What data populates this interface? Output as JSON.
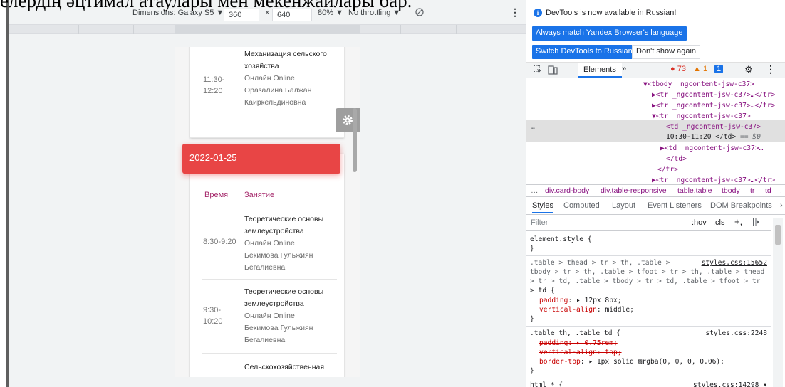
{
  "doc_heading": "елердің әцтимал атаулары мен мекенжайлары бар.",
  "emulation_toolbar": {
    "dimensions_label": "Dimensions: Galaxy S5 ▼",
    "width": "360",
    "times": "×",
    "height": "640",
    "zoom": "80% ▼",
    "throttling": "No throttling ▼",
    "rotate_icon": "rotate-icon",
    "more_icon": "more-vertical-icon"
  },
  "schedule": {
    "card1": {
      "time": "11:30-12:20",
      "subject": "Механизация сельского хозяйства",
      "mode": "Онлайн Online",
      "teacher": "Оразалина Балжан Каиркельдиновна"
    },
    "date_header": "2022-01-25",
    "col_time": "Время",
    "col_lesson": "Занятие",
    "rows": [
      {
        "time": "8:30-9:20",
        "subject": "Теоретические основы землеустройства",
        "mode": "Онлайн Online",
        "teacher": "Бекимова Гульжиян Бегалиевна"
      },
      {
        "time": "9:30-10:20",
        "subject": "Теоретические основы землеустройства",
        "mode": "Онлайн Online",
        "teacher": "Бекимова Гульжиян Бегалиевна"
      },
      {
        "subject": "Сельскохозяйственная"
      }
    ],
    "gear_icon": "gear-icon",
    "accent_color": "#e84545"
  },
  "devtools": {
    "notice": "DevTools is now available in Russian!",
    "btn_match_language": "Always match Yandex Browser's language",
    "btn_switch_russian": "Switch DevTools to Russian",
    "btn_dont_show": "Don't show again",
    "tabs": {
      "inspect_icon": "inspect-icon",
      "device_icon": "device-toggle-icon",
      "elements": "Elements",
      "more": "»",
      "errors": "● 73",
      "warnings": "▲ 1",
      "messages": "1",
      "settings_icon": "gear-icon",
      "menu_icon": "more-vertical-icon"
    },
    "dom_tree": {
      "l1": "▼<tbody _ngcontent-jsw-c37>",
      "l2": "▶<tr _ngcontent-jsw-c37>…</tr>",
      "l3": "▶<tr _ngcontent-jsw-c37>…</tr>",
      "l4": "▼<tr _ngcontent-jsw-c37>",
      "l5_tag": "<td _ngcontent-jsw-c37>",
      "l6_text": "10:30-11:20 </td>",
      "l6_eq": "== $0",
      "l7": "▶<td _ngcontent-jsw-c37>…",
      "l8": "</td>",
      "l9": "</tr>",
      "l10": "▶<tr _ngcontent-jsw-c37>…</tr>",
      "ellipsis": "…"
    },
    "breadcrumbs": [
      "…",
      "div.card-body",
      "div.table-responsive",
      "table.table",
      "tbody",
      "tr",
      "td",
      "."
    ],
    "sub_tabs": [
      "Styles",
      "Computed",
      "Layout",
      "Event Listeners",
      "DOM Breakpoints",
      "›"
    ],
    "filter": {
      "placeholder": "Filter",
      "hov": ":hov",
      "cls": ".cls",
      "plus": "+,",
      "sidebar_icon": "toggle-sidebar-icon"
    },
    "styles": {
      "element_style": "element.style {",
      "close": "}",
      "rule1_selector_l1": ".table > thead > tr > th, .table >",
      "rule1_src": "styles.css:15652",
      "rule1_selector_l2": "tbody > tr > th, .table > tfoot > tr > th, .table > thead",
      "rule1_selector_l3": "> tr > td, .table > tbody > tr > td, .table > tfoot > tr",
      "rule1_selector_l4": "> td {",
      "rule1_padding_prop": "padding",
      "rule1_padding_val": "▸ 12px 8px;",
      "rule1_valign_prop": "vertical-align",
      "rule1_valign_val": "middle;",
      "rule2_selector": ".table th, .table td {",
      "rule2_src": "styles.css:2248",
      "rule2_padding": "padding: ▸ 0.75rem;",
      "rule2_valign": "vertical-align: top;",
      "rule2_border_prop": "border-top",
      "rule2_border_val": "▸ 1px solid ▨rgba(0, 0, 0, 0.06);",
      "rule3_selector": "html * {",
      "rule3_src": "styles.css:14298 ▾"
    }
  }
}
